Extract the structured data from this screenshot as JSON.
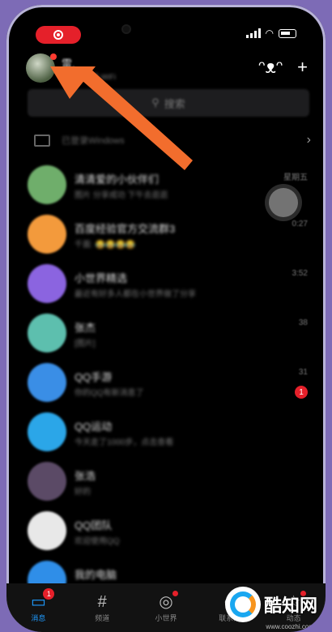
{
  "status_bar": {
    "signal_icon": "signal-icon",
    "wifi_icon": "wifi-icon",
    "battery_icon": "battery-icon",
    "record_icon": "screen-record-icon"
  },
  "header": {
    "nickname": "雷.",
    "online_status": "iPhone在线-WiFi",
    "add_icon": "plus-icon",
    "mascot_icon": "qq-mascot-icon"
  },
  "search": {
    "placeholder": "搜索"
  },
  "windows_notice": {
    "text": "已登录Windows"
  },
  "chats": [
    {
      "name": "清清爱的小伙伴们",
      "preview": "图片 分享成功 下午去逛逛",
      "time": "星期五",
      "avatar_color": "#6fae6b"
    },
    {
      "name": "百度经验官方交流群3",
      "preview": "千面: 😂😂😂😂",
      "time": "0:27",
      "avatar_color": "#f39a3c"
    },
    {
      "name": "小世界精选",
      "preview": "最近有好多人都在小世界做了分享",
      "time": "3:52",
      "avatar_color": "#8b64e0"
    },
    {
      "name": "张杰",
      "preview": "[图片]",
      "time": "38",
      "avatar_color": "#5dbfae"
    },
    {
      "name": "QQ手游",
      "preview": "你的QQ有新消息了",
      "time": "31",
      "avatar_color": "#3a8ee6",
      "unread": "1"
    },
    {
      "name": "QQ运动",
      "preview": "今天走了1000步，点击查看",
      "time": "",
      "avatar_color": "#2ba6e8"
    },
    {
      "name": "张浩",
      "preview": "好的",
      "time": "",
      "avatar_color": "#5b4a66"
    },
    {
      "name": "QQ团队",
      "preview": "欢迎使用QQ",
      "time": "",
      "avatar_color": "#e8e8e8"
    },
    {
      "name": "我的电脑",
      "preview": "",
      "time": "",
      "avatar_color": "#2f8ee8"
    }
  ],
  "tabs": [
    {
      "label": "消息",
      "icon": "chat-bubble-icon",
      "badge": "1",
      "active": true
    },
    {
      "label": "频道",
      "icon": "hashtag-icon"
    },
    {
      "label": "小世界",
      "icon": "world-icon",
      "dot": true
    },
    {
      "label": "联系人",
      "icon": "contacts-icon"
    },
    {
      "label": "动态",
      "icon": "star-icon",
      "dot": true
    }
  ],
  "watermark": {
    "text": "酷知网",
    "url": "www.coozhi.com"
  }
}
